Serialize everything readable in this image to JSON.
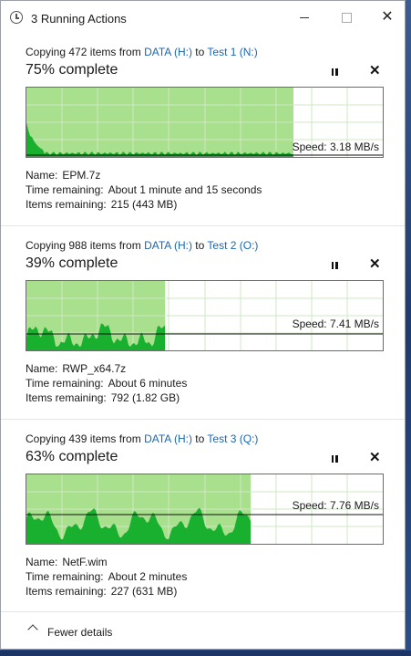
{
  "window": {
    "title": "3 Running Actions"
  },
  "operations": [
    {
      "copying_prefix": "Copying 472 items from ",
      "source": "DATA (H:)",
      "to": " to ",
      "dest": "Test 1 (N:)",
      "percent_text": "75% complete",
      "progress": 0.75,
      "speed": "Speed: 3.18 MB/s",
      "name_label": "Name:",
      "name": "EPM.7z",
      "time_label": "Time remaining:",
      "time": "About 1 minute and 15 seconds",
      "items_label": "Items remaining:",
      "items": "215 (443 MB)"
    },
    {
      "copying_prefix": "Copying 988 items from ",
      "source": "DATA (H:)",
      "to": " to ",
      "dest": "Test 2 (O:)",
      "percent_text": "39% complete",
      "progress": 0.39,
      "speed": "Speed: 7.41 MB/s",
      "name_label": "Name:",
      "name": "RWP_x64.7z",
      "time_label": "Time remaining:",
      "time": "About 6 minutes",
      "items_label": "Items remaining:",
      "items": "792 (1.82 GB)"
    },
    {
      "copying_prefix": "Copying 439 items from ",
      "source": "DATA (H:)",
      "to": " to ",
      "dest": "Test 3 (Q:)",
      "percent_text": "63% complete",
      "progress": 0.63,
      "speed": "Speed: 7.76 MB/s",
      "name_label": "Name:",
      "name": "NetF.wim",
      "time_label": "Time remaining:",
      "time": "About 2 minutes",
      "items_label": "Items remaining:",
      "items": "227 (631 MB)"
    }
  ],
  "footer": {
    "fewer_details": "Fewer details"
  },
  "colors": {
    "fill": "#a8e08d",
    "area": "#18b02e",
    "grid": "#cfe8c4",
    "link": "#1a66b3"
  },
  "icons": {
    "app": "clock-icon",
    "pause": "pause-icon",
    "cancel": "close-icon",
    "collapse": "chevron-up-icon"
  }
}
